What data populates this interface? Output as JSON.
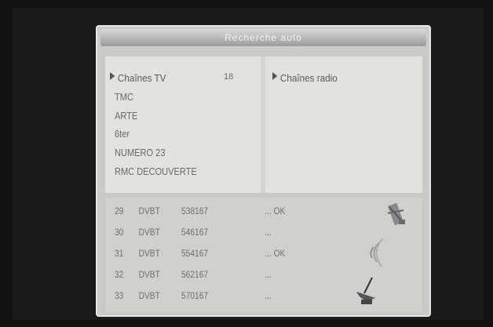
{
  "dialog": {
    "title": "Recherche auto"
  },
  "tv": {
    "header": "Chaînes TV",
    "count": "18",
    "channels": [
      "TMC",
      "ARTE",
      "6ter",
      "NUMERO 23",
      "RMC DECOUVERTE"
    ]
  },
  "radio": {
    "header": "Chaînes radio"
  },
  "log": [
    {
      "num": "29",
      "type": "DVBT",
      "freq": "538167",
      "status": "... OK"
    },
    {
      "num": "30",
      "type": "DVBT",
      "freq": "546167",
      "status": "..."
    },
    {
      "num": "31",
      "type": "DVBT",
      "freq": "554167",
      "status": "... OK"
    },
    {
      "num": "32",
      "type": "DVBT",
      "freq": "562167",
      "status": "..."
    },
    {
      "num": "33",
      "type": "DVBT",
      "freq": "570167",
      "status": "..."
    }
  ],
  "icons": [
    "satellite-icon",
    "signal-waves-icon",
    "antenna-dish-icon"
  ],
  "colors": {
    "dialog_bg": "#c9cbc9",
    "titlebar": "#9b9b9b",
    "panel": "#e2e2e0"
  }
}
